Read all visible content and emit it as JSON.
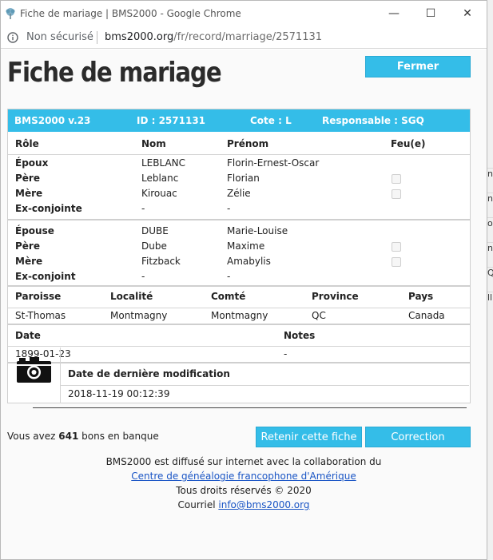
{
  "window": {
    "title": "Fiche de mariage | BMS2000 - Google Chrome",
    "minimize": "—",
    "maximize": "☐",
    "close": "✕"
  },
  "address": {
    "security": "Non sécurisé",
    "host": "bms2000.org",
    "path": "/fr/record/marriage/2571131"
  },
  "page": {
    "title": "Fiche de mariage",
    "close_button": "Fermer"
  },
  "record_header": {
    "version": "BMS2000 v.23",
    "id": "ID : 2571131",
    "cote": "Cote : L",
    "responsable": "Responsable : SGQ"
  },
  "people_table": {
    "headers": [
      "Rôle",
      "Nom",
      "Prénom",
      "Feu(e)"
    ],
    "groom": [
      {
        "role": "Époux",
        "nom": "LEBLANC",
        "prenom": "Florin-Ernest-Oscar"
      },
      {
        "role": "Père",
        "nom": "Leblanc",
        "prenom": "Florian"
      },
      {
        "role": "Mère",
        "nom": "Kirouac",
        "prenom": "Zélie"
      },
      {
        "role": "Ex-conjointe",
        "nom": "-",
        "prenom": "-"
      }
    ],
    "bride": [
      {
        "role": "Épouse",
        "nom": "DUBE",
        "prenom": "Marie-Louise"
      },
      {
        "role": "Père",
        "nom": "Dube",
        "prenom": "Maxime"
      },
      {
        "role": "Mère",
        "nom": "Fitzback",
        "prenom": "Amabylis"
      },
      {
        "role": "Ex-conjoint",
        "nom": "-",
        "prenom": "-"
      }
    ]
  },
  "place_table": {
    "headers": [
      "Paroisse",
      "Localité",
      "Comté",
      "Province",
      "Pays"
    ],
    "values": [
      "St-Thomas",
      "Montmagny",
      "Montmagny",
      "QC",
      "Canada"
    ]
  },
  "date_table": {
    "headers": [
      "Date",
      "Notes"
    ],
    "values": [
      "1899-01-23",
      "-"
    ]
  },
  "modification": {
    "label": "Date de dernière modification",
    "value": "2018-11-19 00:12:39"
  },
  "bank": {
    "prefix": "Vous avez ",
    "count": "641",
    "suffix": " bons en banque"
  },
  "actions": {
    "keep": "Retenir cette fiche",
    "correction": "Correction"
  },
  "footer": {
    "line1": "BMS2000 est diffusé sur internet avec la collaboration du",
    "link": "Centre de généalogie francophone d'Amérique",
    "line3": "Tous droits réservés © 2020",
    "mail_prefix": "Courriel ",
    "mail": "info@bms2000.org"
  },
  "background_fragments": [
    "ny",
    "ny",
    "ole",
    "ny",
    "Q",
    "ll"
  ],
  "colors": {
    "accent": "#34bde8",
    "link": "#1a55c5"
  }
}
